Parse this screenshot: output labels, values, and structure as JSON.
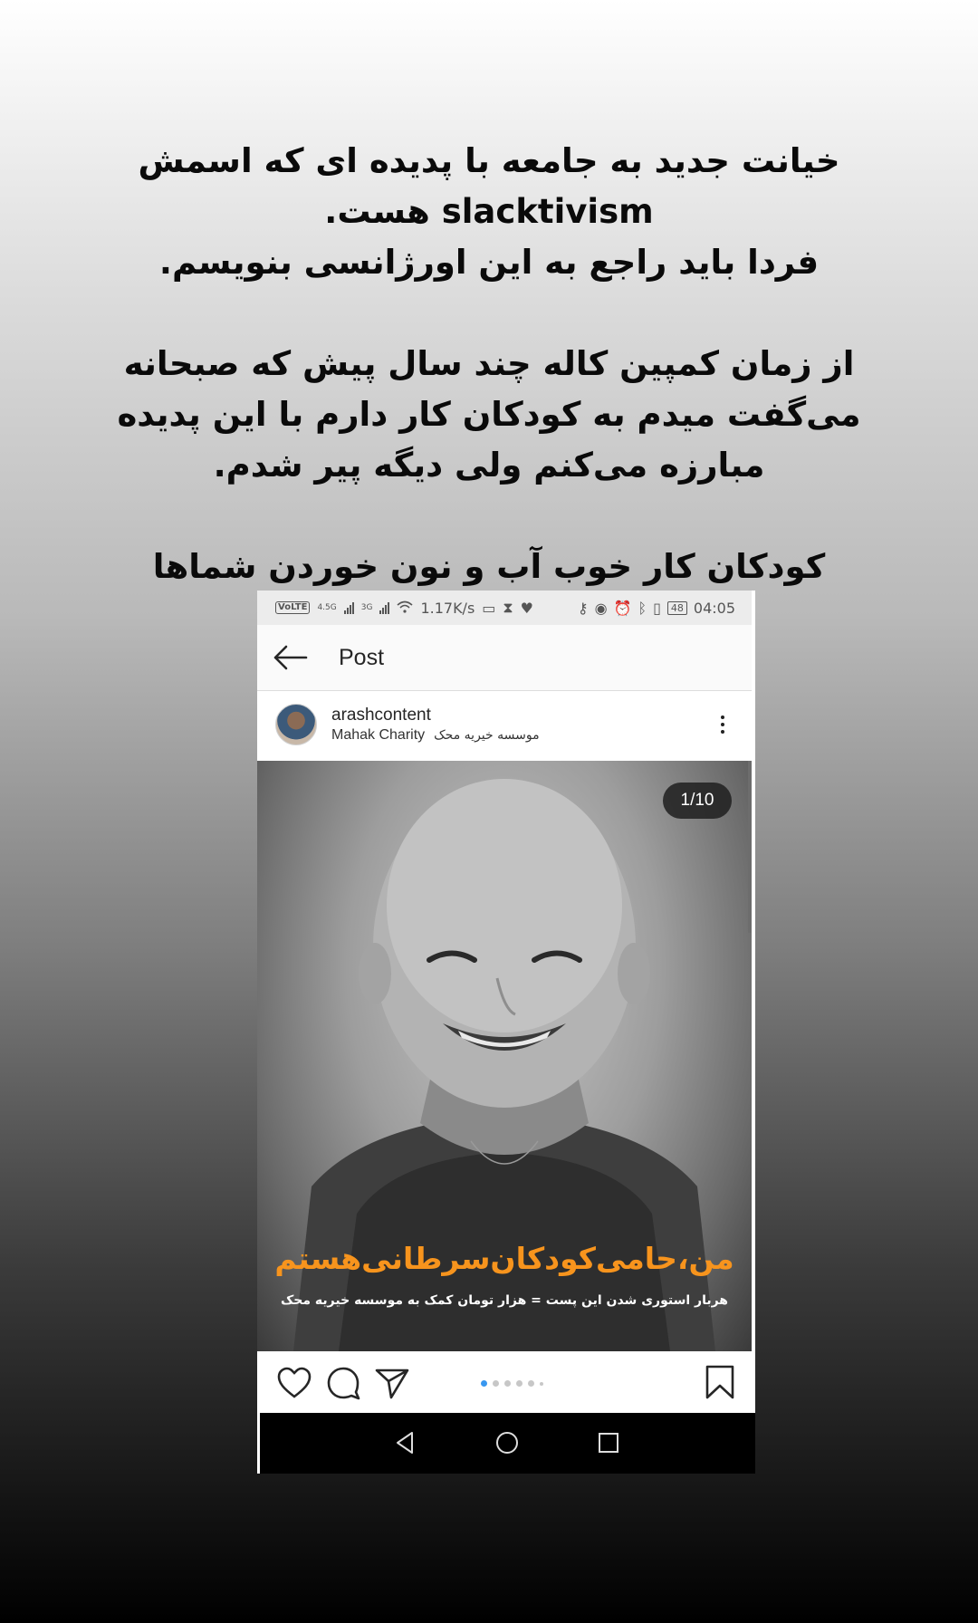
{
  "story": {
    "lines": [
      "خیانت جدید به جامعه با پدیده ای که اسمش",
      "slacktivism هست.",
      "فردا باید راجع به این اورژانسی بنویسم.",
      "",
      "از زمان کمپین کاله چند سال پیش که صبحانه",
      "می‌گفت میدم به کودکان کار دارم با این پدیده",
      "مبارزه می‌کنم ولی دیگه پیر شدم.",
      "",
      "کودکان کار خوب آب و نون خوردن شماها شدن."
    ]
  },
  "screenshot": {
    "status_bar": {
      "volte": "VoLTE",
      "network_1": "4.5G",
      "network_2": "3G",
      "speed": "1.17K/s",
      "battery": "48",
      "time": "04:05"
    },
    "app_bar": {
      "title": "Post"
    },
    "post": {
      "username": "arashcontent",
      "location_en": "Mahak Charity",
      "location_fa": "موسسه خیریه محک",
      "counter": "1/10",
      "overlay_title": "من،حامی‌کودکان‌سرطانی‌هستم",
      "overlay_subtitle": "هربار استوری شدن این پست = هزار تومان کمک به موسسه خیریه محک",
      "carousel": {
        "count": 6,
        "active_index": 0
      }
    },
    "colors": {
      "accent": "#f7941d",
      "dot_active": "#3897f0"
    }
  }
}
